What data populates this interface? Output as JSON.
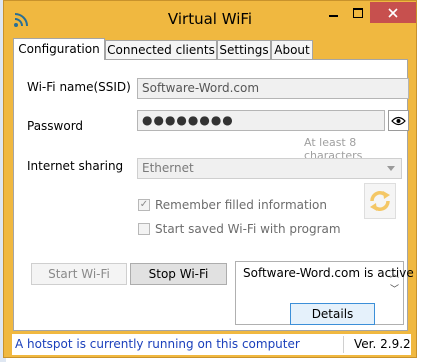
{
  "window": {
    "title": "Virtual WiFi",
    "accent": "#f0b840",
    "close_color": "#c7504e"
  },
  "tabs": [
    {
      "label": "Configuration",
      "active": true
    },
    {
      "label": "Connected clients",
      "active": false
    },
    {
      "label": "Settings",
      "active": false
    },
    {
      "label": "About",
      "active": false
    }
  ],
  "config": {
    "ssid_label": "Wi-Fi name(SSID)",
    "ssid_value": "Software-Word.com",
    "password_label": "Password",
    "password_value": "●●●●●●●●",
    "password_hint": "At least 8 characters",
    "sharing_label": "Internet sharing",
    "sharing_value": "Ethernet",
    "remember_label": "Remember filled information",
    "remember_checked": true,
    "start_with_program_label": "Start saved Wi-Fi with program",
    "start_with_program_checked": false
  },
  "buttons": {
    "start": "Start Wi-Fi",
    "stop": "Stop Wi-Fi",
    "details": "Details"
  },
  "status_box": {
    "text": "Software-Word.com is active"
  },
  "statusbar": {
    "message": "A hotspot is currently running on this computer",
    "version": "Ver. 2.9.2"
  },
  "icons": {
    "app": "wifi-icon",
    "password_toggle": "eye-icon",
    "refresh": "refresh-icon",
    "close": "close-icon",
    "minimize": "minimize-icon",
    "maximize": "maximize-icon"
  }
}
